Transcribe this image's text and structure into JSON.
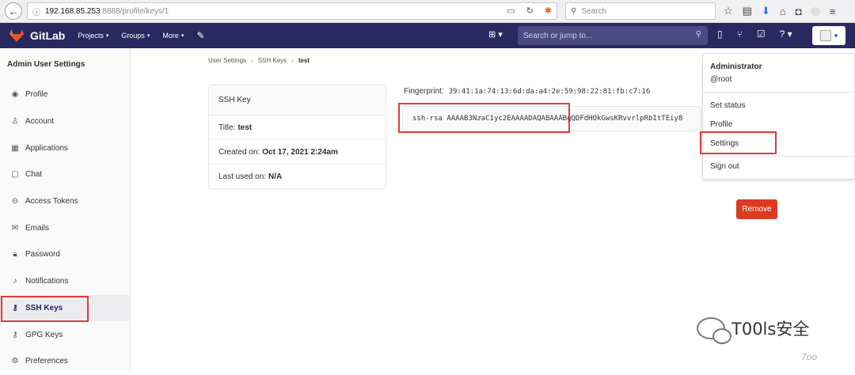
{
  "browser": {
    "url_host": "192.168.85.253",
    "url_path": ":8888/profile/keys/1",
    "search_placeholder": "Search"
  },
  "navbar": {
    "brand": "GitLab",
    "items": [
      "Projects",
      "Groups",
      "More"
    ],
    "search_placeholder": "Search or jump to..."
  },
  "sidebar": {
    "header": "Admin  User Settings",
    "items": [
      {
        "label": "Profile",
        "icon": "user-circle-icon"
      },
      {
        "label": "Account",
        "icon": "account-icon"
      },
      {
        "label": "Applications",
        "icon": "applications-icon"
      },
      {
        "label": "Chat",
        "icon": "chat-icon"
      },
      {
        "label": "Access Tokens",
        "icon": "token-icon"
      },
      {
        "label": "Emails",
        "icon": "mail-icon"
      },
      {
        "label": "Password",
        "icon": "lock-icon"
      },
      {
        "label": "Notifications",
        "icon": "bell-icon"
      },
      {
        "label": "SSH Keys",
        "icon": "key-icon"
      },
      {
        "label": "GPG Keys",
        "icon": "key-icon"
      },
      {
        "label": "Preferences",
        "icon": "preferences-icon"
      }
    ]
  },
  "breadcrumb": {
    "items": [
      "User Settings",
      "SSH Keys"
    ],
    "current": "test"
  },
  "key_card": {
    "header": "SSH Key",
    "title_label": "Title:",
    "title_value": "test",
    "created_label": "Created on:",
    "created_value": "Oct 17, 2021 2:24am",
    "last_used_label": "Last used on:",
    "last_used_value": "N/A"
  },
  "fingerprint": {
    "label": "Fingerprint:",
    "value": "39:41:1a:74:13:6d:da:a4:2e:59:98:22:81:fb:c7:16"
  },
  "key_text": "ssh-rsa AAAAB3NzaC1yc2EAAAADAQABAAABgQDFdHOkGwsKRvvrlpRbItTEiy8",
  "dropdown": {
    "name": "Administrator",
    "handle": "@root",
    "items": [
      "Set status",
      "Profile",
      "Settings",
      "Sign out"
    ]
  },
  "remove_label": "Remove",
  "watermark": {
    "text": "T00ls安全",
    "small": "7oo"
  }
}
